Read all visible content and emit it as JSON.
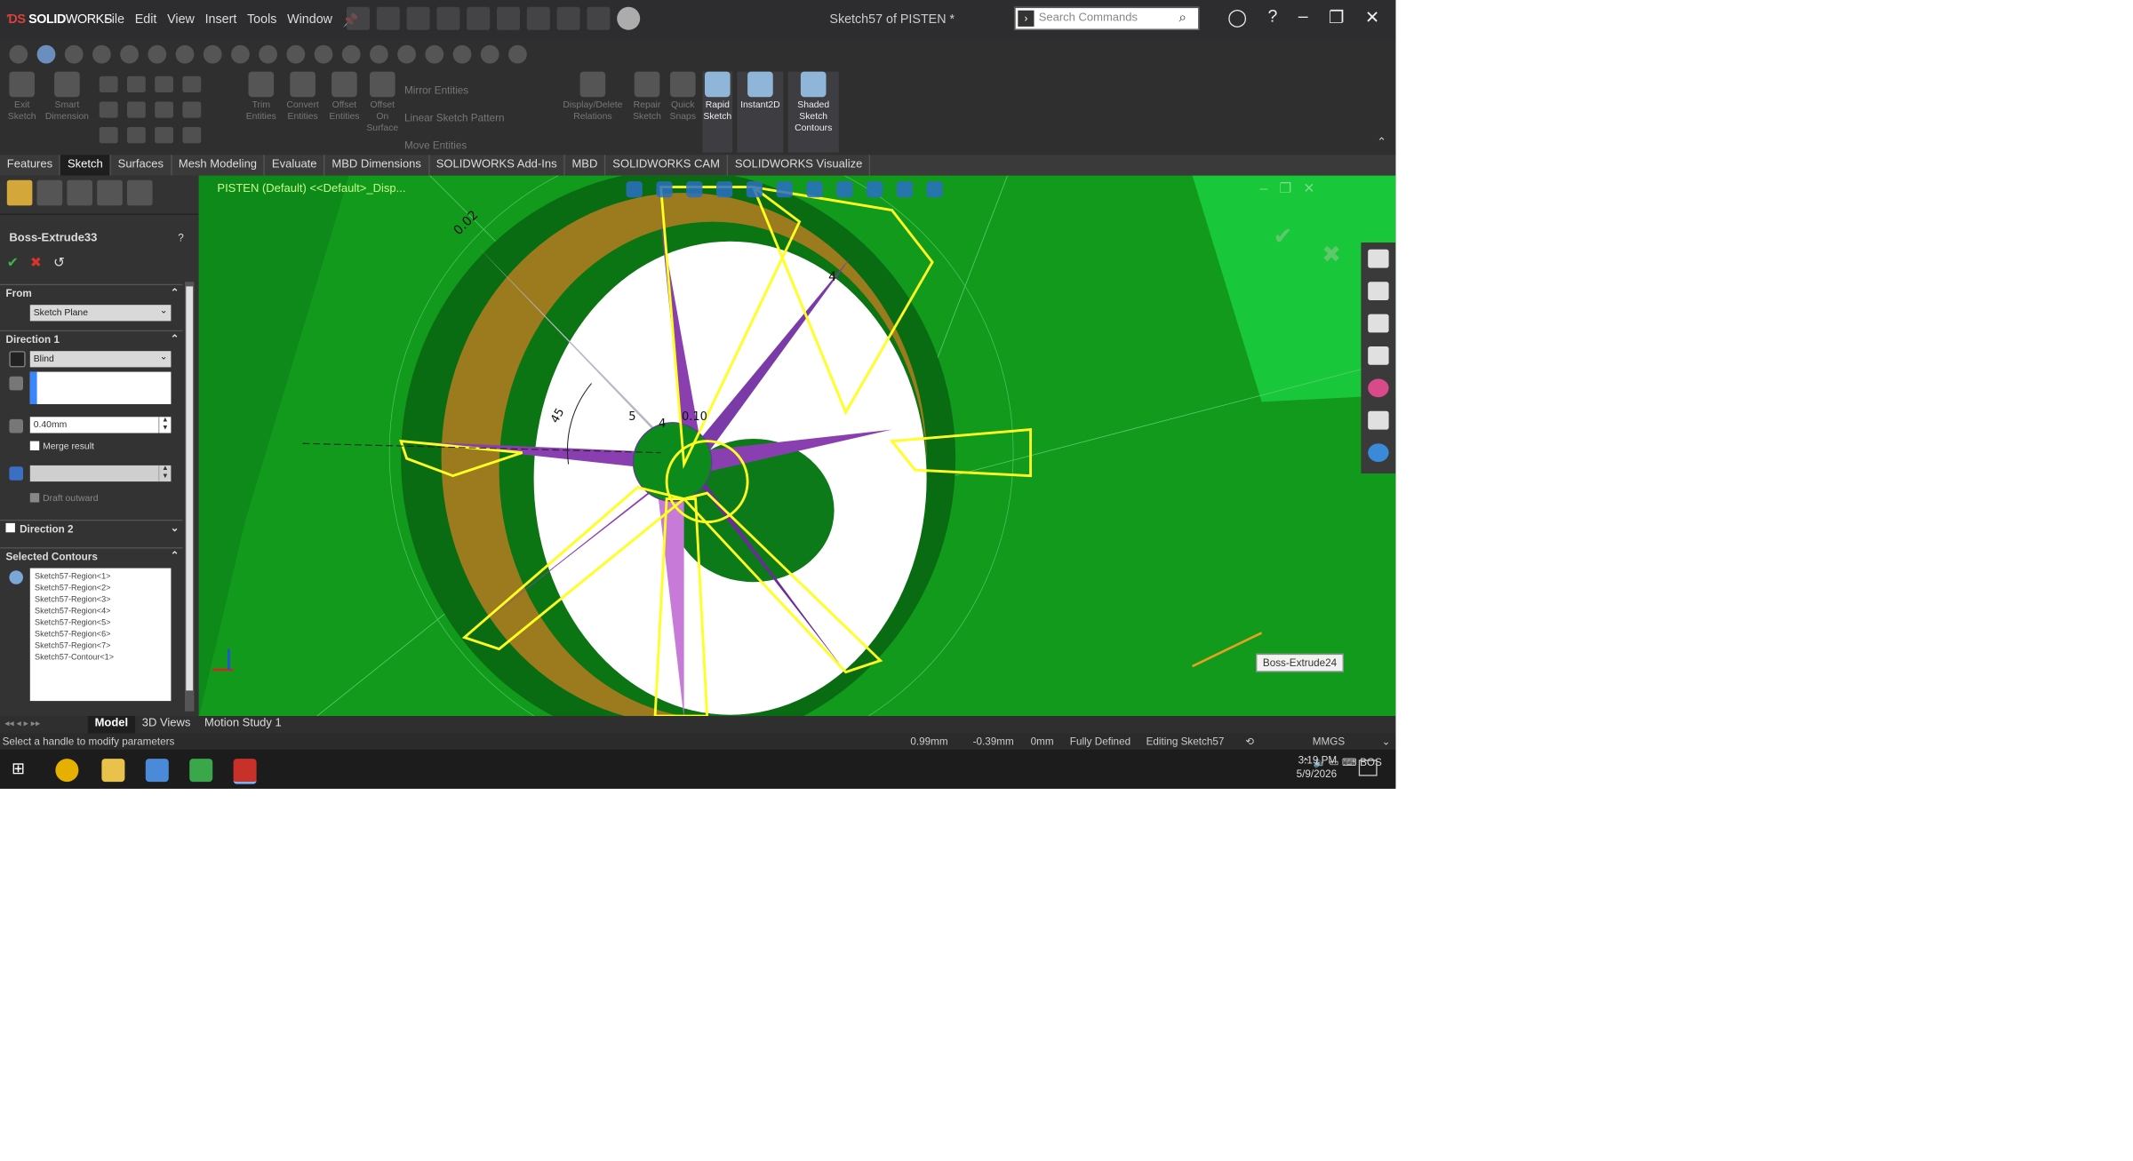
{
  "titlebar": {
    "brand_bold": "SOLID",
    "brand_rest": "WORKS",
    "menu": [
      "File",
      "Edit",
      "View",
      "Insert",
      "Tools",
      "Window"
    ],
    "doc_title": "Sketch57 of PISTEN *",
    "search_placeholder": "Search Commands"
  },
  "commands": {
    "exit_sketch": "Exit Sketch",
    "smart_dimension": "Smart Dimension",
    "trim_entities": "Trim Entities",
    "convert_entities": "Convert Entities",
    "offset_entities": "Offset Entities",
    "offset_on_surface": "Offset On Surface",
    "mirror_entities": "Mirror Entities",
    "linear_pattern": "Linear Sketch Pattern",
    "move_entities": "Move Entities",
    "display_delete_relations": "Display/Delete Relations",
    "repair_sketch": "Repair Sketch",
    "quick_snaps": "Quick Snaps",
    "rapid_sketch": "Rapid Sketch",
    "instant2d": "Instant2D",
    "shaded_contours": "Shaded Sketch Contours"
  },
  "tabs": [
    "Features",
    "Sketch",
    "Surfaces",
    "Mesh Modeling",
    "Evaluate",
    "MBD Dimensions",
    "SOLIDWORKS Add-Ins",
    "MBD",
    "SOLIDWORKS CAM",
    "SOLIDWORKS Visualize"
  ],
  "active_tab": "Sketch",
  "property_manager": {
    "feature_title": "Boss-Extrude33",
    "help": "?",
    "from_header": "From",
    "from_value": "Sketch Plane",
    "direction1_header": "Direction 1",
    "end_condition": "Blind",
    "depth": "0.40mm",
    "merge_result": "Merge result",
    "draft_outward": "Draft outward",
    "direction2_header": "Direction 2",
    "selected_contours_header": "Selected Contours",
    "contours": [
      "Sketch57-Region<1>",
      "Sketch57-Region<2>",
      "Sketch57-Region<3>",
      "Sketch57-Region<4>",
      "Sketch57-Region<5>",
      "Sketch57-Region<6>",
      "Sketch57-Region<7>",
      "Sketch57-Contour<1>"
    ]
  },
  "viewport": {
    "tree_label": "PISTEN (Default) <<Default>_Disp...",
    "dims": [
      "0.02",
      "4",
      "45",
      "4",
      "5",
      "0.10"
    ],
    "callout": "Boss-Extrude24",
    "colors": {
      "background": "#0e8a1a",
      "wheel": "#9a7a1e",
      "spoke": "#8a3fb0",
      "preview": "#ffff00"
    }
  },
  "bottom_tabs": [
    "Model",
    "3D Views",
    "Motion Study 1"
  ],
  "active_bottom_tab": "Model",
  "status": {
    "hint": "Select a handle to modify parameters",
    "x": "0.99mm",
    "y": "-0.39mm",
    "z": "0mm",
    "state": "Fully Defined",
    "editing": "Editing Sketch57",
    "units": "MMGS"
  },
  "taskbar": {
    "tray_lang": "BOS",
    "time": "3:19 PM",
    "date": "5/9/2026"
  }
}
